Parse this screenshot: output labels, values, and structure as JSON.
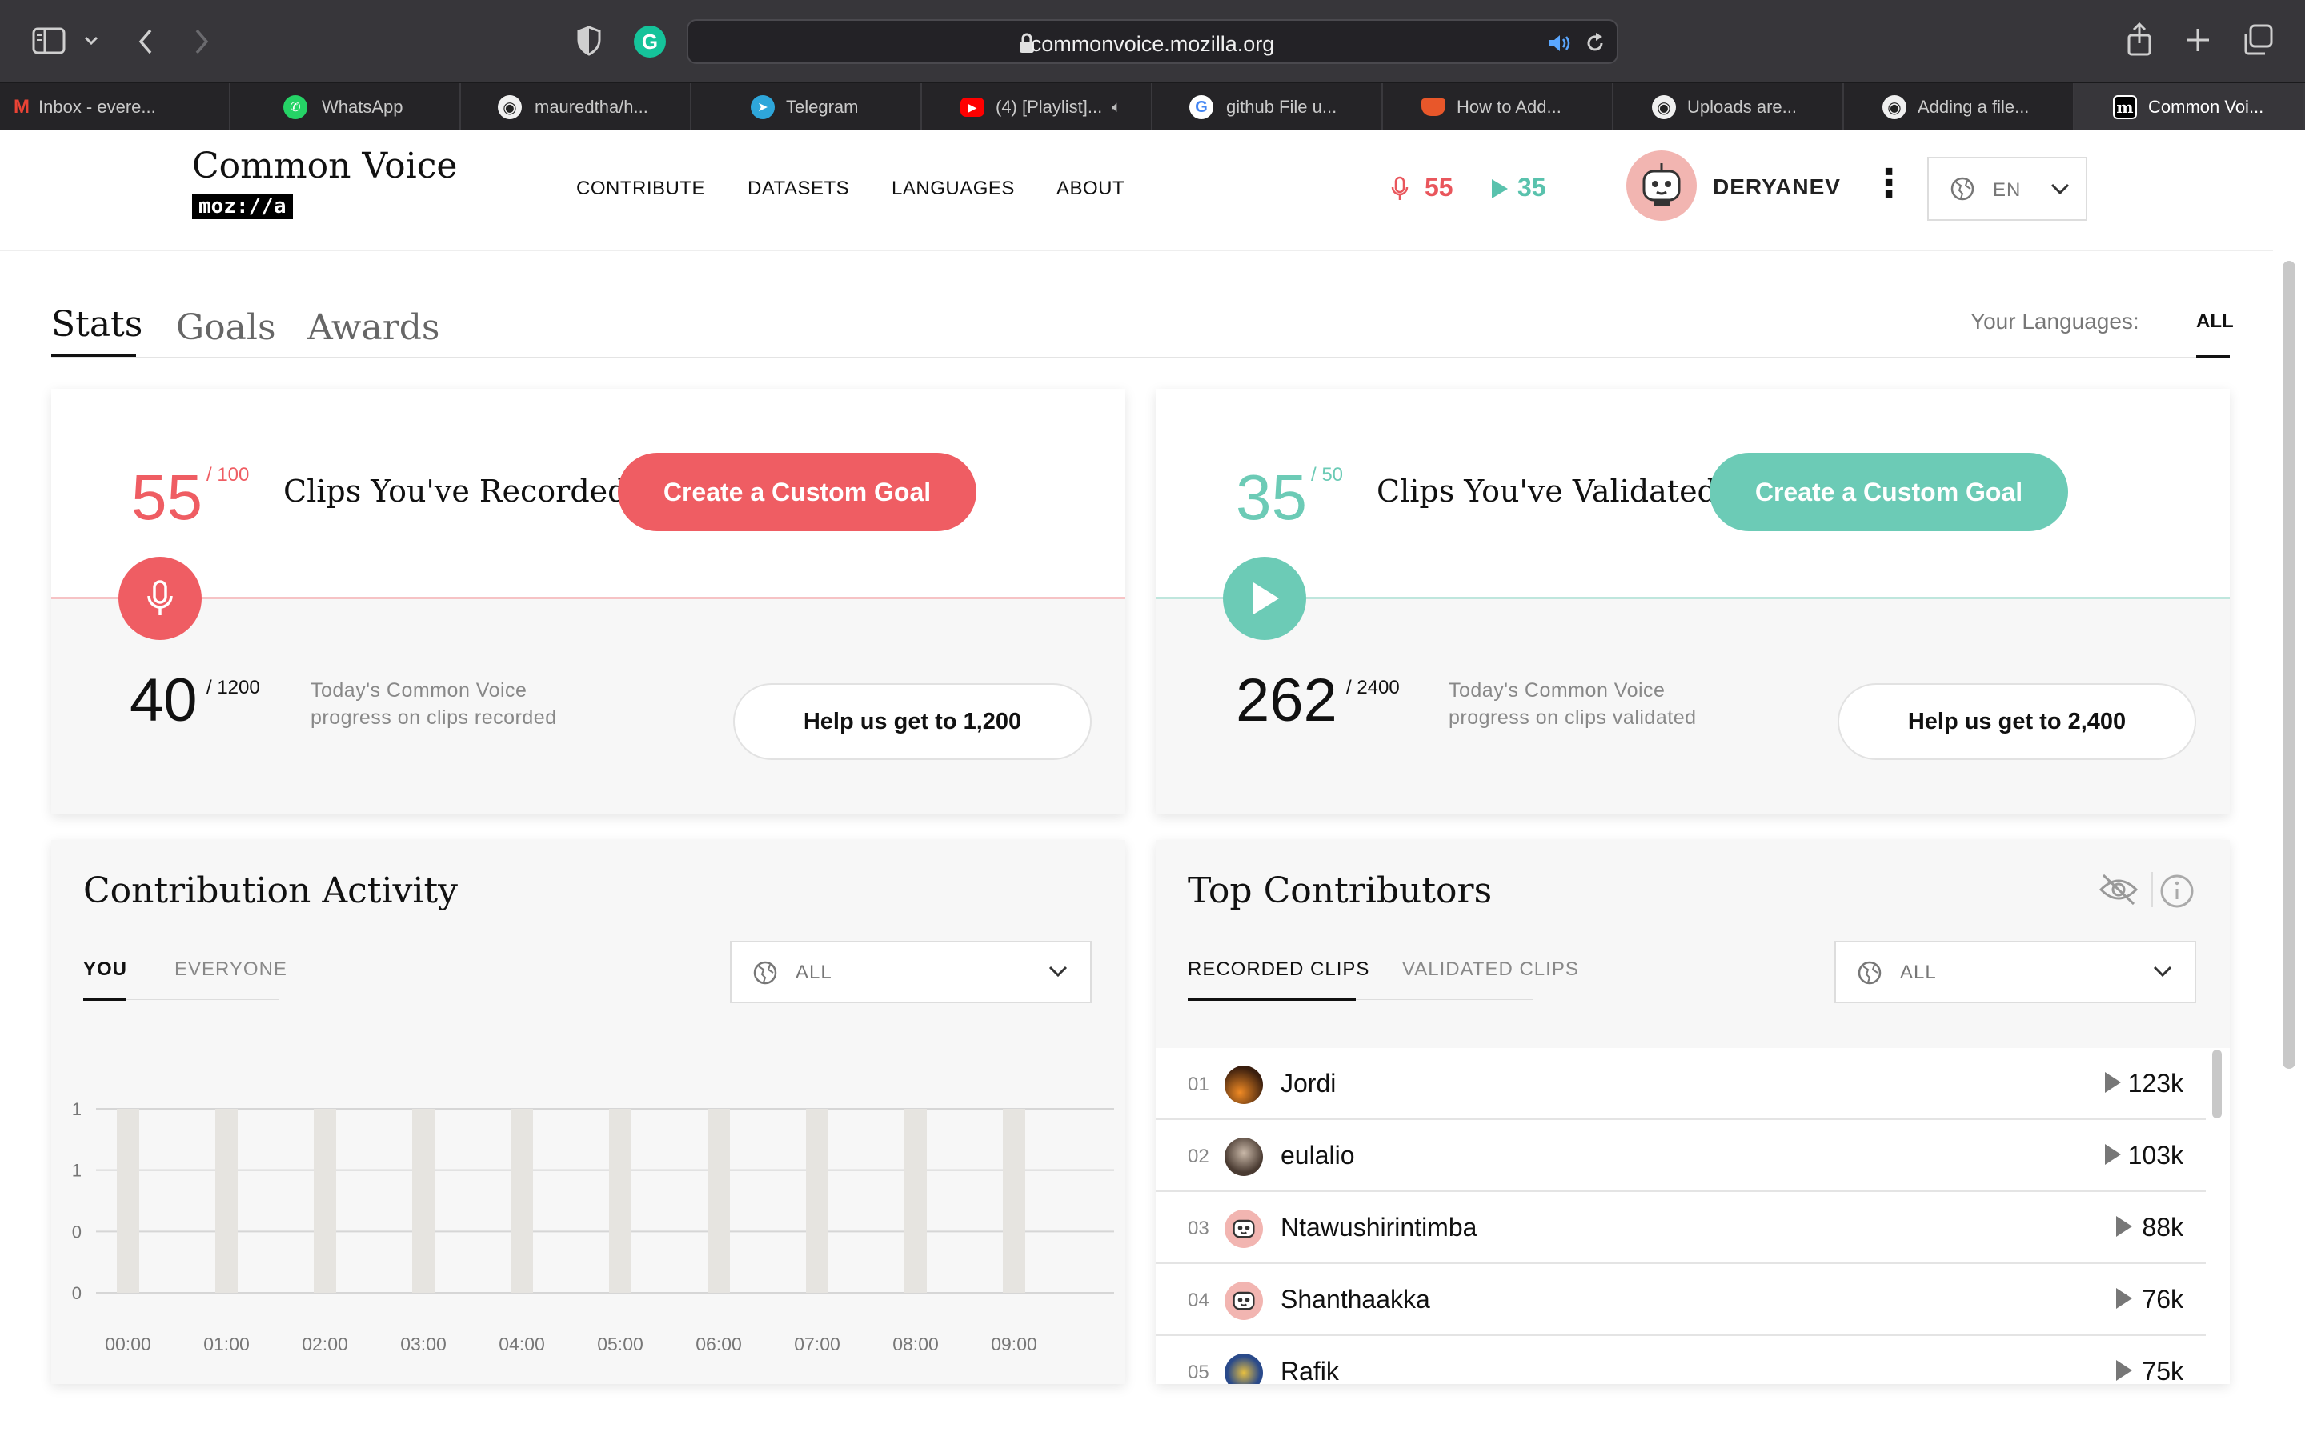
{
  "browser": {
    "url": "commonvoice.mozilla.org",
    "tabs": [
      {
        "label": "Inbox - evere...",
        "icon": "gmail-icon"
      },
      {
        "label": "WhatsApp",
        "icon": "whatsapp-icon"
      },
      {
        "label": "mauredtha/h...",
        "icon": "github-icon"
      },
      {
        "label": "Telegram",
        "icon": "telegram-icon"
      },
      {
        "label": "(4) [Playlist]...",
        "icon": "youtube-icon"
      },
      {
        "label": "github File u...",
        "icon": "google-icon"
      },
      {
        "label": "How to Add...",
        "icon": "cup-icon"
      },
      {
        "label": "Uploads are...",
        "icon": "github-icon"
      },
      {
        "label": "Adding a file...",
        "icon": "github-icon"
      },
      {
        "label": "Common Voi...",
        "icon": "mdn-icon"
      }
    ]
  },
  "header": {
    "logo_title": "Common Voice",
    "logo_sub": "moz://a",
    "nav": [
      "CONTRIBUTE",
      "DATASETS",
      "LANGUAGES",
      "ABOUT"
    ],
    "recorded_count": "55",
    "validated_count": "35",
    "username": "DERYANEV",
    "language": "EN"
  },
  "dashboard": {
    "tabs": [
      "Stats",
      "Goals",
      "Awards"
    ],
    "your_languages_label": "Your Languages:",
    "language_filter": "ALL"
  },
  "goals": {
    "recorded": {
      "count": "55",
      "target": "/ 100",
      "title": "Clips You've Recorded",
      "button": "Create a Custom Goal",
      "today_count": "40",
      "today_target": "/ 1200",
      "today_text_1": "Today's Common Voice",
      "today_text_2": "progress on clips recorded",
      "help_button": "Help us get to 1,200"
    },
    "validated": {
      "count": "35",
      "target": "/ 50",
      "title": "Clips You've Validated",
      "button": "Create a Custom Goal",
      "today_count": "262",
      "today_target": "/ 2400",
      "today_text_1": "Today's Common Voice",
      "today_text_2": "progress on clips validated",
      "help_button": "Help us get to 2,400"
    }
  },
  "activity": {
    "title": "Contribution Activity",
    "tabs": [
      "YOU",
      "EVERYONE"
    ],
    "filter": "ALL"
  },
  "chart_data": {
    "type": "bar",
    "categories": [
      "00:00",
      "01:00",
      "02:00",
      "03:00",
      "04:00",
      "05:00",
      "06:00",
      "07:00",
      "08:00",
      "09:00"
    ],
    "values": [
      1,
      1,
      1,
      1,
      1,
      1,
      1,
      1,
      1,
      1
    ],
    "y_tick_labels": [
      "1",
      "1",
      "0",
      "0"
    ],
    "ylim": [
      0,
      1
    ],
    "grid": true
  },
  "contributors": {
    "title": "Top Contributors",
    "tabs": [
      "RECORDED CLIPS",
      "VALIDATED CLIPS"
    ],
    "filter": "ALL",
    "rows": [
      {
        "rank": "01",
        "name": "Jordi",
        "count": "123k",
        "avatar": "photo"
      },
      {
        "rank": "02",
        "name": "eulalio",
        "count": "103k",
        "avatar": "photo"
      },
      {
        "rank": "03",
        "name": "Ntawushirintimba",
        "count": "88k",
        "avatar": "robot"
      },
      {
        "rank": "04",
        "name": "Shanthaakka",
        "count": "76k",
        "avatar": "robot"
      },
      {
        "rank": "05",
        "name": "Rafik",
        "count": "75k",
        "avatar": "photo"
      }
    ]
  },
  "colors": {
    "record": "#ef5d63",
    "validate": "#6ccbb6"
  }
}
